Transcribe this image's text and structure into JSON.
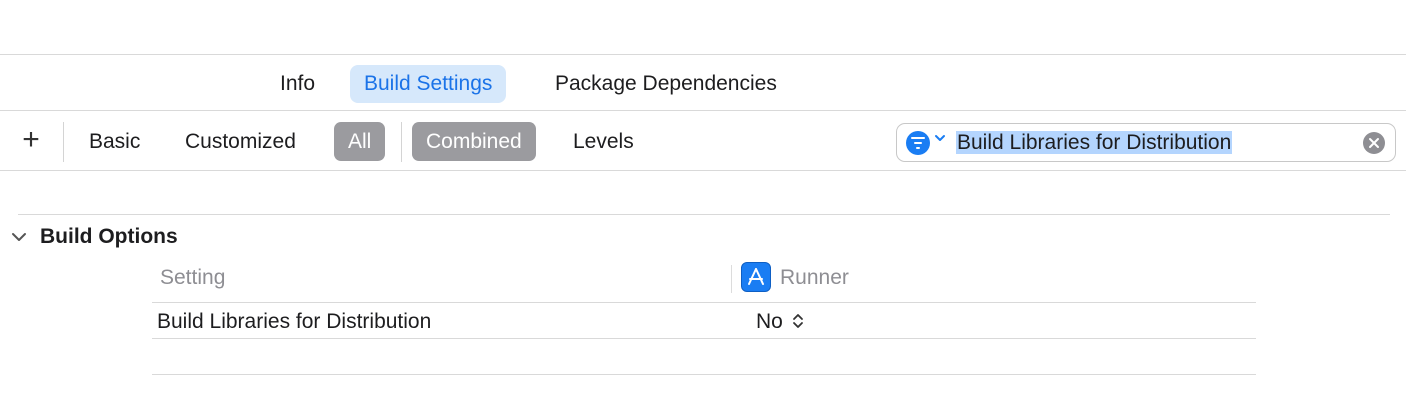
{
  "tabs": [
    {
      "label": "Info",
      "active": false
    },
    {
      "label": "Build Settings",
      "active": true
    },
    {
      "label": "Package Dependencies",
      "active": false
    }
  ],
  "toolbar": {
    "add_icon": "plus-icon",
    "scope_filters": [
      {
        "label": "Basic",
        "selected": false
      },
      {
        "label": "Customized",
        "selected": false
      },
      {
        "label": "All",
        "selected": true
      }
    ],
    "view_filters": [
      {
        "label": "Combined",
        "selected": true
      },
      {
        "label": "Levels",
        "selected": false
      }
    ],
    "search": {
      "value": "Build Libraries for Distribution",
      "filter_icon": "filter-icon",
      "clear_icon": "clear-icon"
    }
  },
  "section": {
    "title": "Build Options",
    "expanded": true,
    "columns": {
      "setting": "Setting",
      "target": "Runner"
    },
    "rows": [
      {
        "setting": "Build Libraries for Distribution",
        "value": "No"
      }
    ]
  },
  "colors": {
    "accent": "#1a7df3",
    "tab_active_bg": "#d6e8fb",
    "tab_active_text": "#1b73e8",
    "filter_selected_bg": "#9b9b9f",
    "search_selection": "#b4d5fe"
  }
}
